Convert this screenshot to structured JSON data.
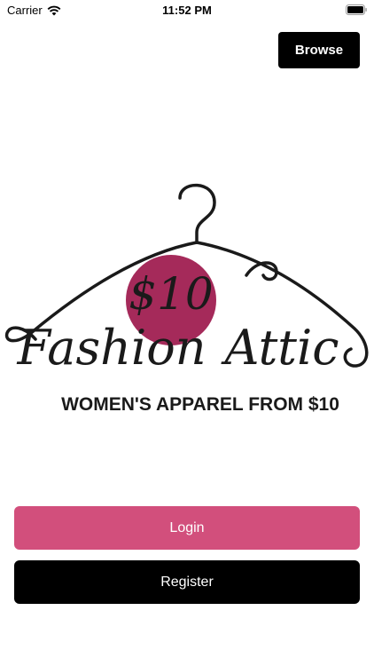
{
  "status_bar": {
    "carrier": "Carrier",
    "time": "11:52 PM",
    "wifi_icon": "wifi-icon",
    "battery_icon": "battery-icon"
  },
  "header": {
    "browse_label": "Browse"
  },
  "logo": {
    "price": "$10",
    "name_line1": "Fashion",
    "name_line2": "Attic",
    "tagline": "WOMEN'S APPAREL FROM $10",
    "icon": "hanger-icon",
    "accent_color": "#a52a5a"
  },
  "actions": {
    "login_label": "Login",
    "register_label": "Register"
  },
  "colors": {
    "login": "#d24f7c",
    "register": "#000000",
    "browse": "#000000"
  }
}
